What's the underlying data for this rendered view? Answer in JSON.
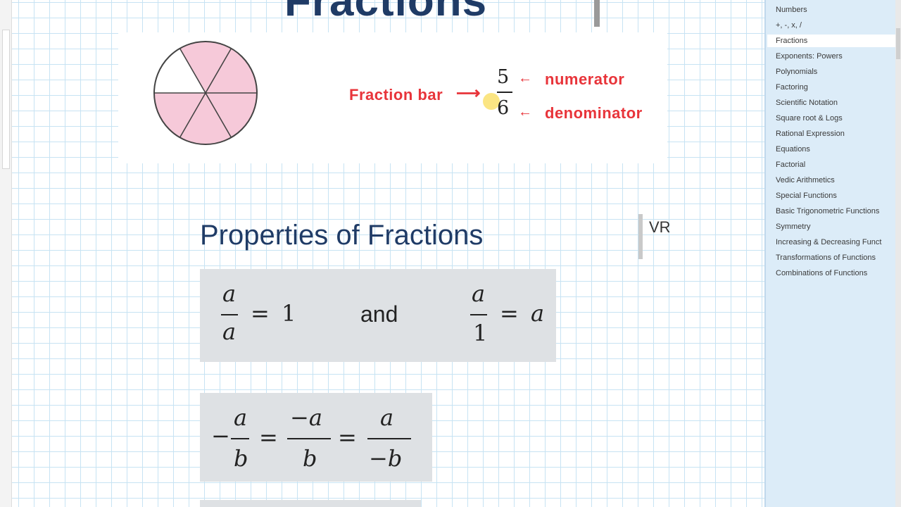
{
  "page": {
    "title": "Fractions",
    "properties_heading": "Properties of Fractions",
    "vr_label": "VR"
  },
  "diagram": {
    "fraction_bar_label": "Fraction bar",
    "numerator_label": "numerator",
    "denominator_label": "denominator",
    "numerator_value": "5",
    "denominator_value": "6",
    "arrow_symbol": "←",
    "arrow_right_symbol": "⟶",
    "pie_total_slices": 6,
    "pie_filled_slices": 5,
    "pie_fill_color": "#f6c9d9"
  },
  "formulas": {
    "box1": {
      "var_a": "a",
      "one": "1",
      "equals": "=",
      "and_word": "and"
    },
    "box2": {
      "minus": "−",
      "var_a": "a",
      "var_b": "b",
      "neg_a": "−a",
      "neg_b": "−b",
      "equals": "="
    }
  },
  "nav": {
    "items": [
      "Numbers",
      "+, -, x, /",
      "Fractions",
      "Exponents: Powers",
      "Polynomials",
      "Factoring",
      "Scientific Notation",
      "Square root & Logs",
      "Rational Expression",
      "Equations",
      "Factorial",
      "Vedic Arithmetics",
      "Special Functions",
      "Basic Trigonometric Functions",
      "Symmetry",
      "Increasing & Decreasing Funct",
      "Transformations of Functions",
      "Combinations of Functions"
    ],
    "selected_index": 2
  },
  "colors": {
    "title": "#1f3b66",
    "annotation_red": "#e8343a",
    "panel_bg": "#dcecf8",
    "grid": "#c7e3f3"
  }
}
